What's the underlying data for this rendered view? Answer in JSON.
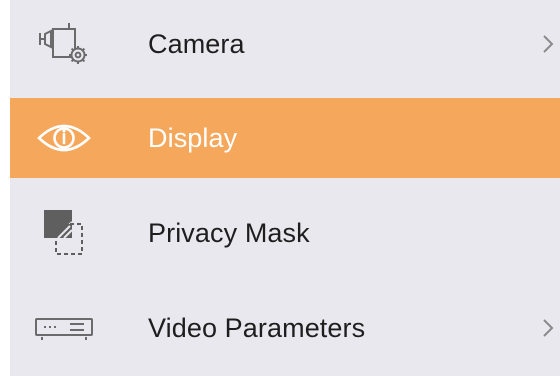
{
  "menu": {
    "accent_color": "#f5a75c",
    "background_color": "#e9e8ee",
    "items": [
      {
        "label": "Camera",
        "icon": "camera-settings-icon",
        "active": false,
        "has_submenu": true
      },
      {
        "label": "Display",
        "icon": "eye-icon",
        "active": true,
        "has_submenu": false
      },
      {
        "label": "Privacy Mask",
        "icon": "privacy-mask-icon",
        "active": false,
        "has_submenu": false
      },
      {
        "label": "Video Parameters",
        "icon": "video-parameters-icon",
        "active": false,
        "has_submenu": true
      }
    ]
  }
}
